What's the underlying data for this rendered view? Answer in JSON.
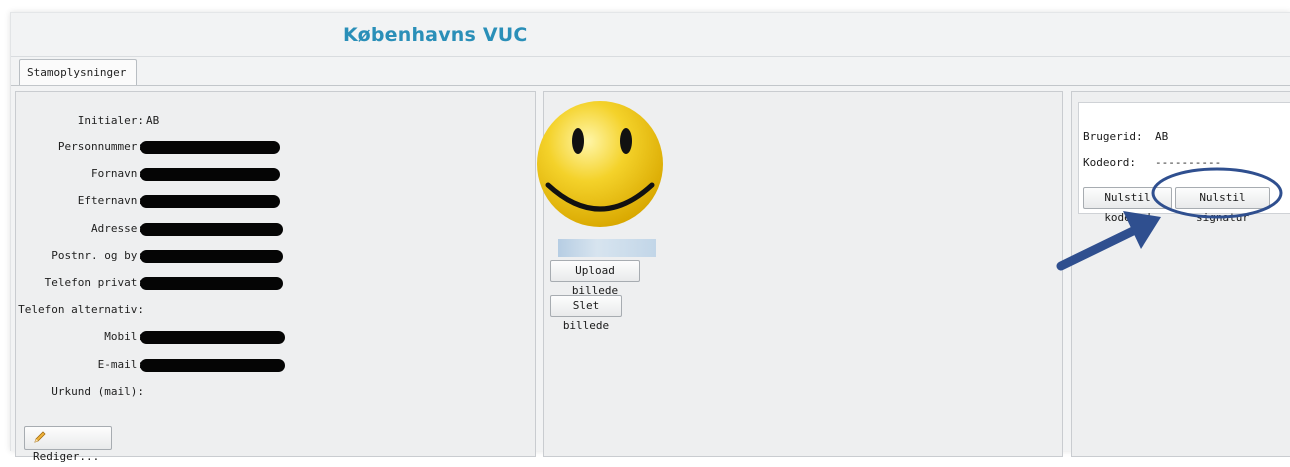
{
  "header": {
    "title": "Københavns VUC"
  },
  "tabs": [
    {
      "label": "Stamoplysninger"
    }
  ],
  "profile": {
    "fields": [
      {
        "label": "Initialer:",
        "value": "AB",
        "redacted": false
      },
      {
        "label": "Personnummer:",
        "value": "",
        "redacted": true
      },
      {
        "label": "Fornavn:",
        "value": "",
        "redacted": true
      },
      {
        "label": "Efternavn:",
        "value": "",
        "redacted": true
      },
      {
        "label": "Adresse:",
        "value": "",
        "redacted": true
      },
      {
        "label": "Postnr. og by:",
        "value": "",
        "redacted": true
      },
      {
        "label": "Telefon privat:",
        "value": "",
        "redacted": true
      },
      {
        "label": "Telefon alternativ:",
        "value": "",
        "redacted": false
      },
      {
        "label": "Mobil:",
        "value": "",
        "redacted": true
      },
      {
        "label": "E-mail:",
        "value": "",
        "redacted": true
      },
      {
        "label": "Urkund (mail):",
        "value": "",
        "redacted": false
      }
    ],
    "edit_button": "Rediger..."
  },
  "photo": {
    "upload_button": "Upload billede",
    "delete_button": "Slet billede"
  },
  "account": {
    "userid_label": "Brugerid:",
    "userid_value": "AB",
    "password_label": "Kodeord:",
    "password_value": "----------",
    "reset_password_button": "Nulstil kodeord",
    "reset_signature_button": "Nulstil signatur"
  },
  "overlays": {
    "smiley_color": "#f4d22a",
    "highlight_color": "#2f4f8f",
    "arrow_color": "#2f4f8f",
    "redaction_color": "#050505"
  }
}
